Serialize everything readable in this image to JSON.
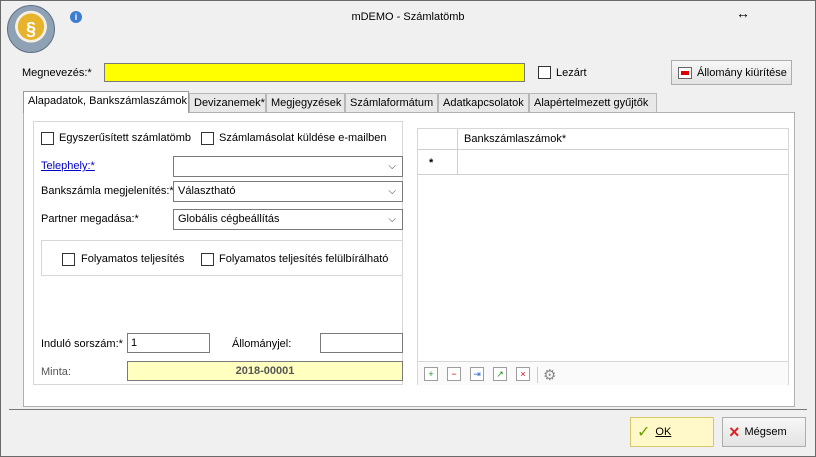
{
  "window": {
    "title": "mDEMO - Számlatömb"
  },
  "header": {
    "name_label": "Megnevezés:*",
    "name_value": "",
    "closed_label": "Lezárt",
    "clear_button": "Állomány kiürítése"
  },
  "tabs": [
    "Alapadatok, Bankszámlaszámok",
    "Devizanemek*",
    "Megjegyzések",
    "Számlaformátum",
    "Adatkapcsolatok",
    "Alapértelmezett gyűjtők"
  ],
  "form": {
    "simple_invoice_label": "Egyszerűsített számlatömb",
    "email_copy_label": "Számlamásolat küldése e-mailben",
    "site_label": "Telephely:*",
    "site_value": "",
    "bank_display_label": "Bankszámla megjelenítés:*",
    "bank_display_value": "Választható",
    "partner_label": "Partner megadása:*",
    "partner_value": "Globális cégbeállítás",
    "continuous_label": "Folyamatos teljesítés",
    "continuous_override_label": "Folyamatos teljesítés felülbírálható",
    "start_serial_label": "Induló sorszám:*",
    "start_serial_value": "1",
    "file_mark_label": "Állományjel:",
    "file_mark_value": "",
    "sample_label": "Minta:",
    "sample_value": "2018-00001"
  },
  "grid": {
    "column": "Bankszámlaszámok*",
    "new_row_marker": "*",
    "toolbar": [
      "add-icon",
      "delete-icon",
      "import-icon",
      "export-icon",
      "remove-icon",
      "settings-icon"
    ]
  },
  "footer": {
    "ok_label": "OK",
    "cancel_label": "Mégsem"
  },
  "colors": {
    "highlight_yellow": "#ffff00",
    "sample_field": "#ffffc0",
    "link_blue": "#0000cc"
  }
}
